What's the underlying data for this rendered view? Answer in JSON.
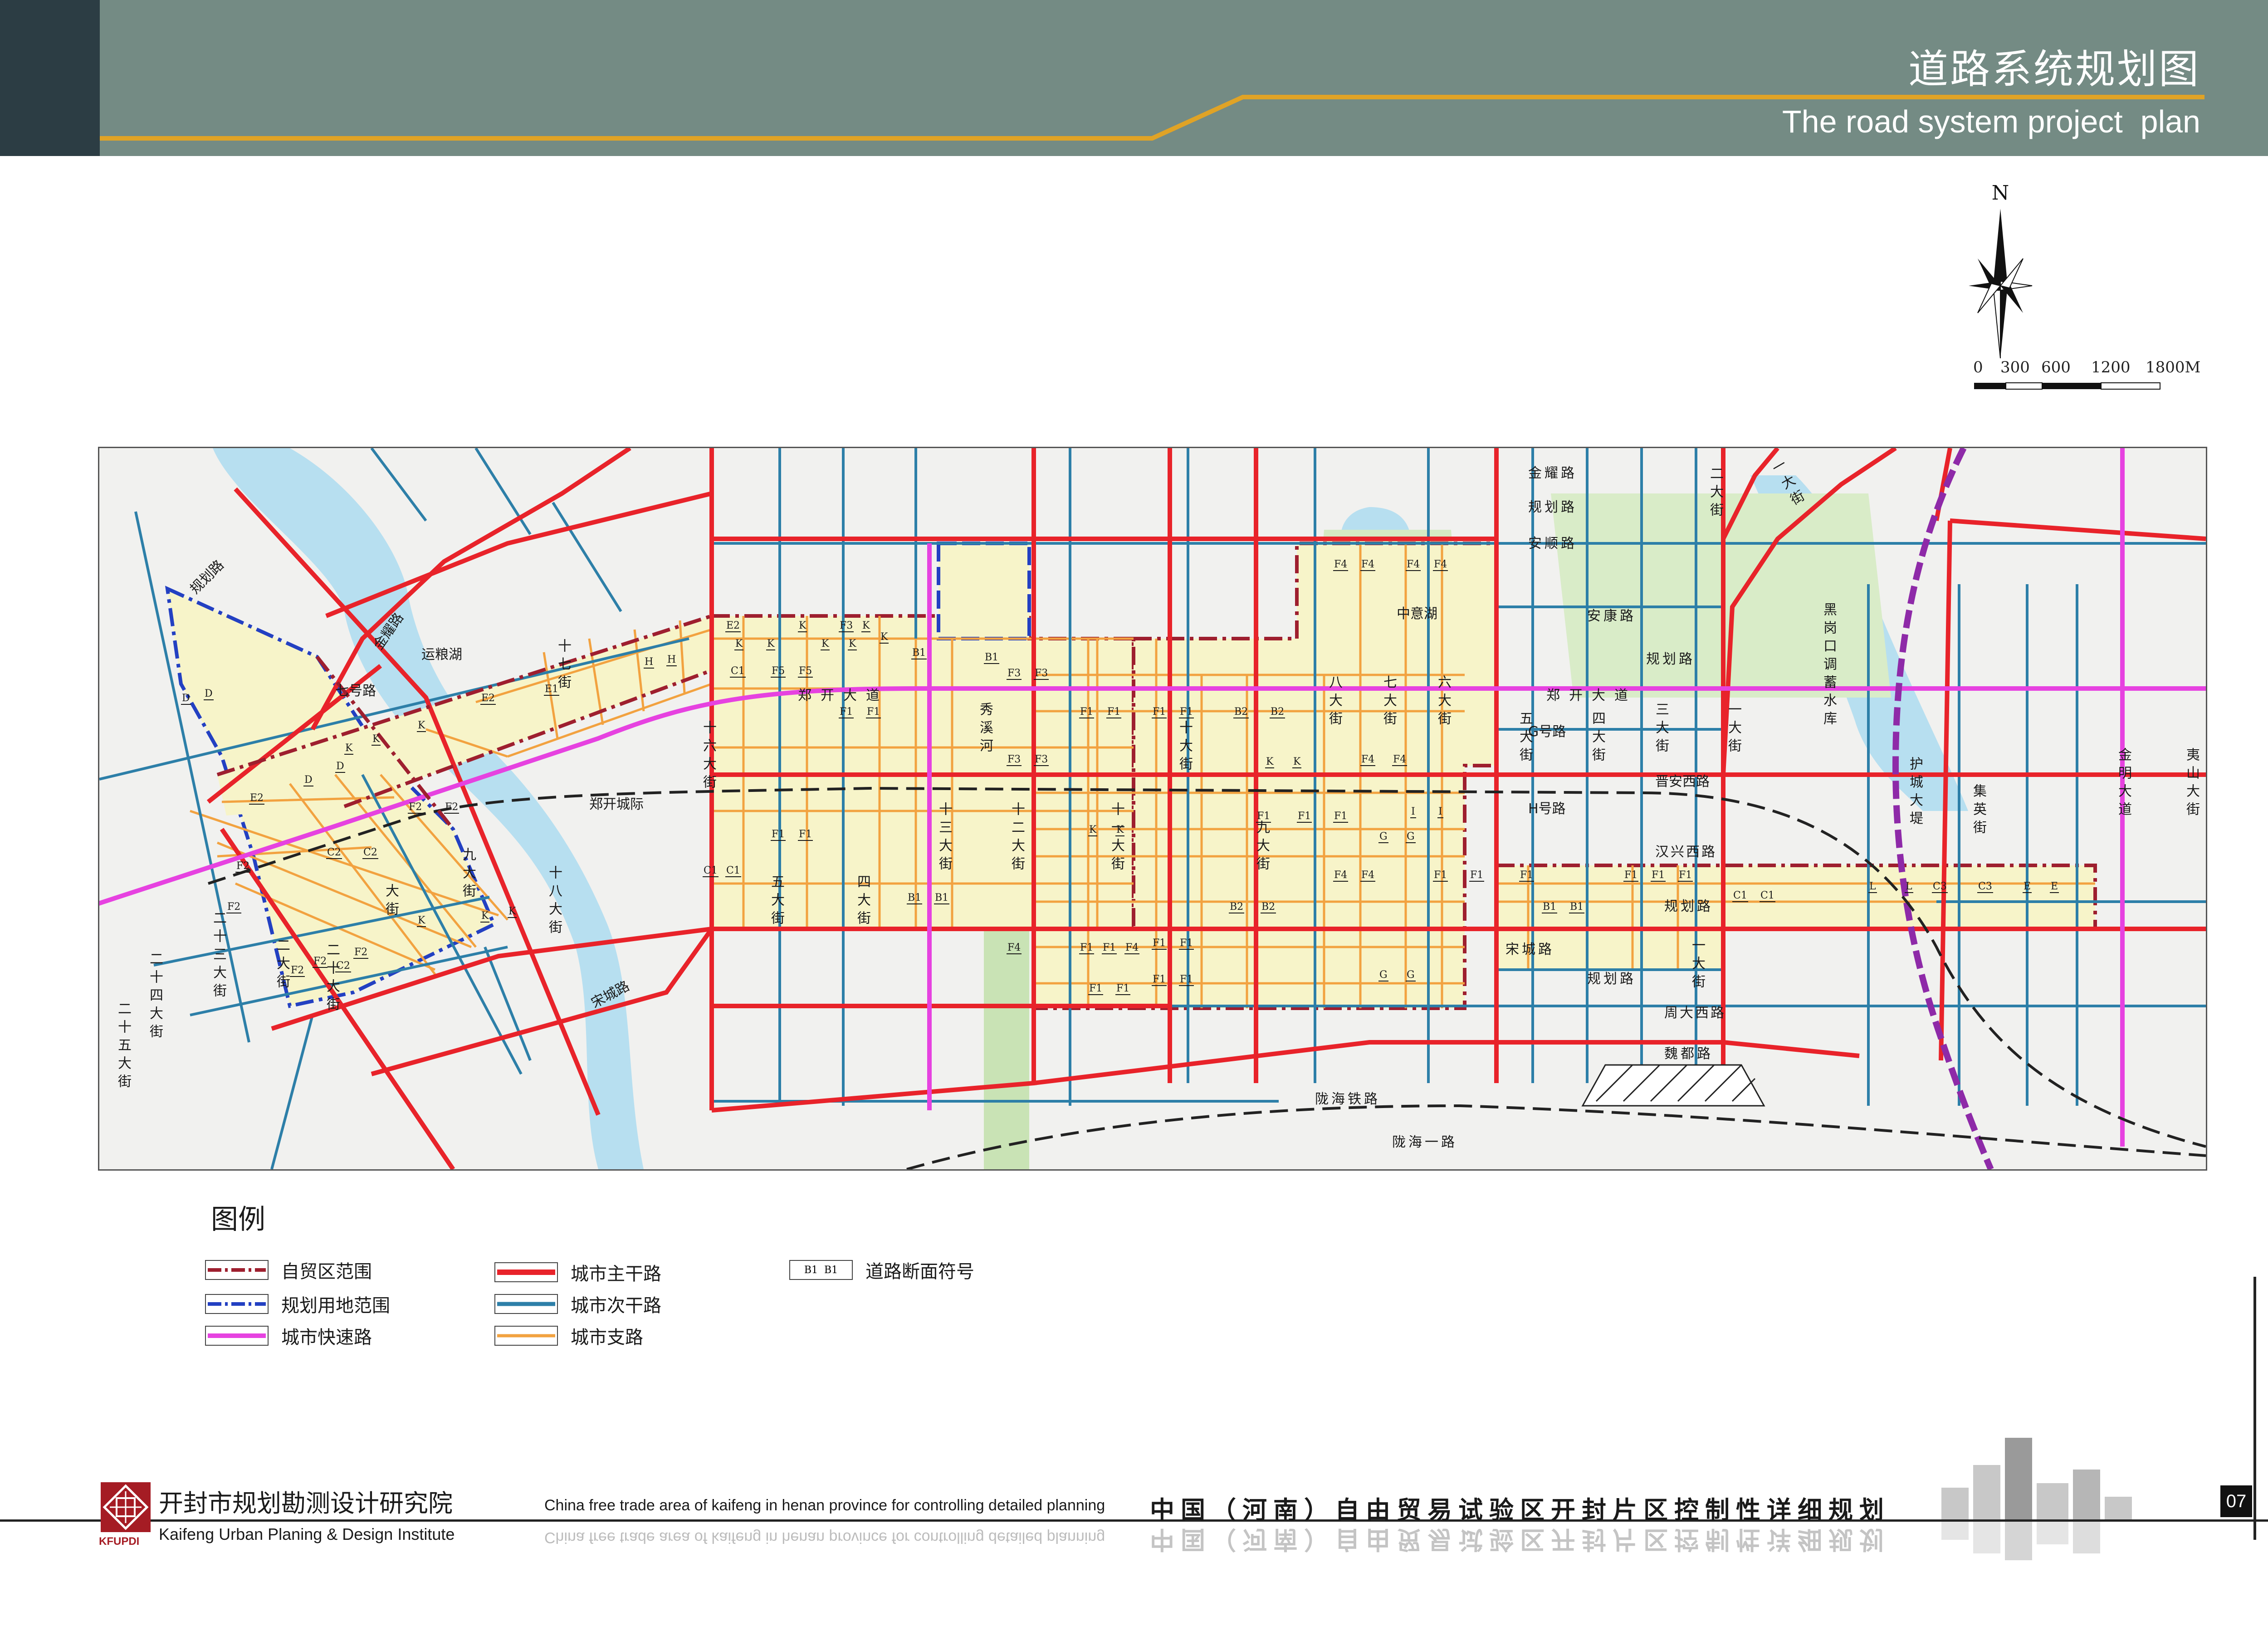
{
  "header": {
    "title_cn": "道路系统规划图",
    "title_en": "The road system project  plan",
    "band_color": "#748b84",
    "accent_color": "#e0a326"
  },
  "compass": {
    "north_label": "N"
  },
  "scale": {
    "labels": [
      "0",
      "300",
      "600",
      "1200",
      "1800M"
    ]
  },
  "map": {
    "colors": {
      "main_road": "#e8232a",
      "secondary_road": "#2d7fa8",
      "branch_road": "#f2a240",
      "expressway": "#e642e0",
      "ftz_boundary": "#9e1f2f",
      "plan_boundary": "#2340c2",
      "dev_land": "#f7f4c9",
      "green": "#c9e3b5",
      "water": "#b7dff0",
      "railway": "#222222"
    },
    "labels": {
      "guihua_nw": "规划路",
      "yunliang_lake": "运粮湖",
      "jinming_nw": "金耀路",
      "qihao": "七号路",
      "shiqi": "十七街",
      "zhengkai_road": "郑开大道",
      "zhengkai_road2": "郑开大道",
      "zhengkai_intercity": "郑开城际",
      "xiuxi_river": "秀溪河",
      "shiliu": "十六大街",
      "shisan": "十三大街",
      "shier": "十二大街",
      "shiyi": "十一大街",
      "shi": "十大街",
      "jiu": "九大街",
      "jiu_w": "九大街",
      "shiba": "十八大街",
      "shijiu": "大街",
      "wu": "五大街",
      "si": "四大街",
      "ershisi": "二十四大街",
      "ershisan": "二十三大街",
      "ershiwu": "二十五大街",
      "ershier": "二大街",
      "ershi": "二十大街",
      "songcheng": "宋城路",
      "songcheng_e": "宋城路",
      "zhongyi_lake": "中意湖",
      "ba": "八大街",
      "qi": "七大街",
      "liu": "六大街",
      "wu_e": "五大街",
      "si_e": "四大街",
      "san": "三大街",
      "er_n": "二大街",
      "yi_n": "一大街",
      "yi_s": "一大街",
      "yi_e": "一大街",
      "jinyao": "金耀路",
      "guihua_n": "规划路",
      "anshun": "安顺路",
      "ankang": "安康路",
      "guihua_e": "规划路",
      "ghao": "G号路",
      "hhao": "H号路",
      "jinanxi": "晋安西路",
      "hanxingxi": "汉兴西路",
      "guihua_se": "规划路",
      "guihua_s": "规划路",
      "zhoudaxi": "周大西路",
      "weidu": "魏都路",
      "longhai_rail": "陇海铁路",
      "longhai_1": "陇海一路",
      "heigangkou": "黑岗口调蓄水库",
      "hucheng": "护城大堤",
      "jiying": "集英街",
      "jinming": "金明大道",
      "yishan": "夷山大街"
    },
    "sections": [
      "D",
      "D",
      "E2",
      "D",
      "D",
      "B1",
      "E2",
      "K",
      "K",
      "K",
      "K",
      "K",
      "E2",
      "E1",
      "H",
      "H",
      "C1",
      "K",
      "K",
      "K",
      "K",
      "F3",
      "K",
      "B1",
      "C1",
      "F5",
      "F5",
      "F3",
      "F3",
      "F1",
      "F1",
      "F3",
      "F3",
      "F1",
      "F1",
      "F1",
      "F1",
      "B2",
      "B2",
      "F4",
      "F4",
      "F4",
      "F4",
      "F4",
      "F4",
      "F1",
      "F1",
      "F1",
      "K",
      "K",
      "K",
      "K",
      "B1",
      "F2",
      "C2",
      "C2",
      "F2",
      "F2",
      "F2",
      "F2",
      "C1",
      "F1",
      "F1",
      "F4",
      "F4",
      "G",
      "G",
      "I",
      "I",
      "F1",
      "F1",
      "B2",
      "B2",
      "F4",
      "F4",
      "F1",
      "F1",
      "F1",
      "F1",
      "F1",
      "F1",
      "F1",
      "F1",
      "C1",
      "C1",
      "L",
      "L",
      "C3",
      "C3",
      "E",
      "E",
      "B1",
      "B1",
      "G",
      "G",
      "F1",
      "F1",
      "F1",
      "F1",
      "B1",
      "F2",
      "F2",
      "C2",
      "K",
      "K",
      "K"
    ]
  },
  "legend": {
    "title": "图例",
    "items": [
      {
        "key": "ftz",
        "label": "自贸区范围"
      },
      {
        "key": "plan",
        "label": "规划用地范围"
      },
      {
        "key": "express",
        "label": "城市快速路"
      },
      {
        "key": "main",
        "label": "城市主干路"
      },
      {
        "key": "secondary",
        "label": "城市次干路"
      },
      {
        "key": "branch",
        "label": "城市支路"
      },
      {
        "key": "section",
        "label": "道路断面符号",
        "swatch_text": "B1  B1"
      }
    ]
  },
  "footer": {
    "org_cn": "开封市规划勘测设计研究院",
    "org_en": "Kaifeng Urban Planing & Design Institute",
    "logo_abbr": "KFUPDI",
    "project_en": "China free trade area of kaifeng in henan province for controlling detailed planning",
    "project_cn": "中国（河南）自由贸易试验区开封片区控制性详细规划",
    "page_number": "07"
  }
}
